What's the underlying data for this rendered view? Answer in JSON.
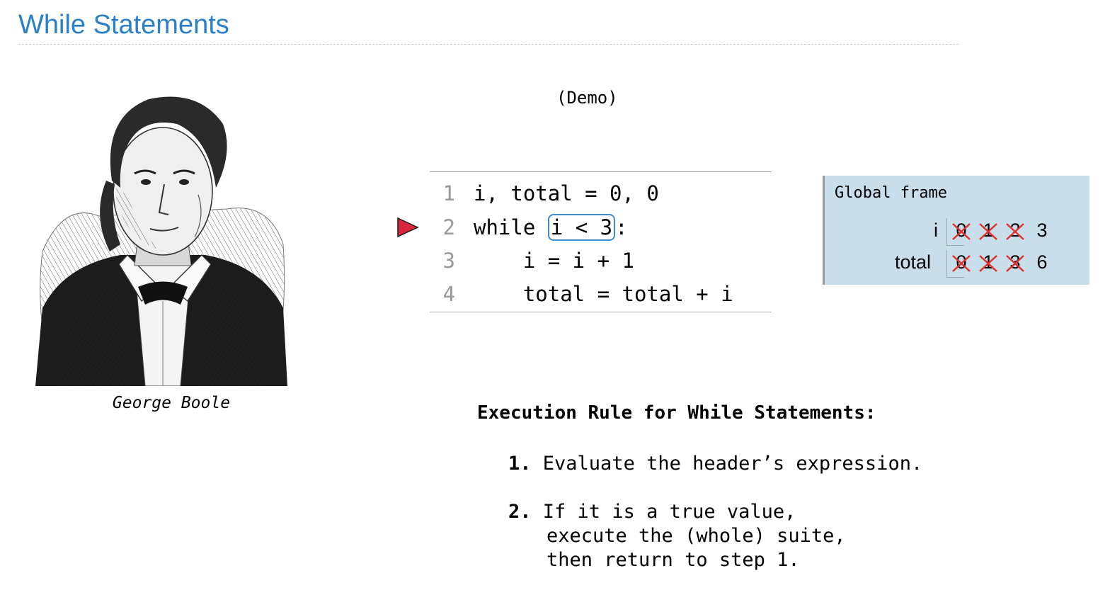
{
  "slide": {
    "title": "While Statements",
    "demo_label": "(Demo)",
    "portrait_caption": "George Boole"
  },
  "code": {
    "lines": [
      {
        "number": "1",
        "text": "i, total = 0, 0"
      },
      {
        "number": "2",
        "keyword": "while",
        "condition": "i < 3",
        "suffix": ":"
      },
      {
        "number": "3",
        "text": "    i = i + 1"
      },
      {
        "number": "4",
        "text": "    total = total + i"
      }
    ],
    "current_line_icon": "red-triangle-arrow-icon"
  },
  "frame": {
    "title": "Global frame",
    "vars": [
      {
        "name": "i",
        "old_values": [
          "0",
          "1",
          "2"
        ],
        "value": "3"
      },
      {
        "name": "total",
        "old_values": [
          "0",
          "1",
          "3"
        ],
        "value": "6"
      }
    ]
  },
  "rule": {
    "heading": "Execution Rule for While Statements:",
    "steps": [
      {
        "num": "1.",
        "lines": [
          "Evaluate the header’s expression."
        ]
      },
      {
        "num": "2.",
        "lines": [
          "If it is a true value,",
          "execute the (whole) suite,",
          "then return to step 1."
        ]
      }
    ]
  },
  "colors": {
    "title": "#2a7fc9",
    "frame_bg": "#c8dfeb",
    "arrow": "#d7263d",
    "strike": "#e0322e",
    "condition_box": "#3a8ccc"
  }
}
